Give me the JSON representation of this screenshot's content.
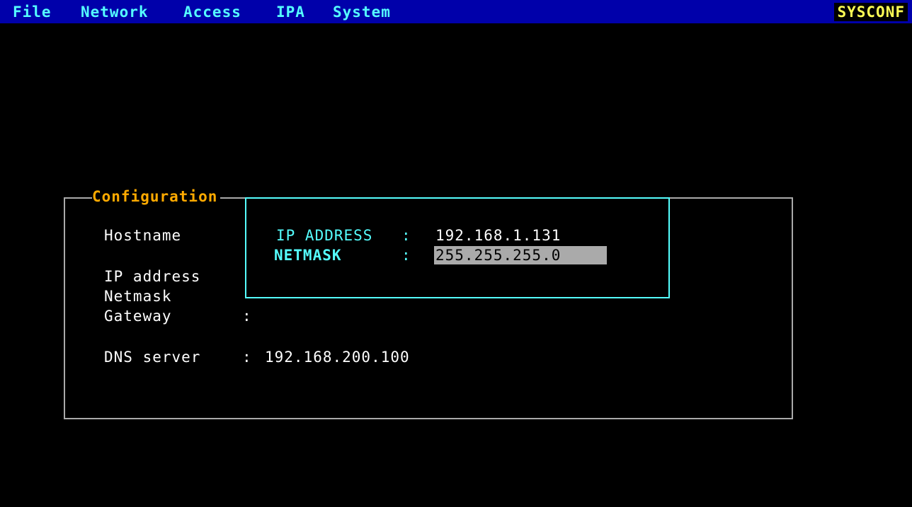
{
  "menu": {
    "items": [
      {
        "label": "File"
      },
      {
        "label": "Network"
      },
      {
        "label": "Access"
      },
      {
        "label": "IPA"
      },
      {
        "label": "System"
      }
    ],
    "app_name": "SYSCONF"
  },
  "config": {
    "title": "Configuration",
    "fields": {
      "hostname": {
        "label": "Hostname",
        "value": ""
      },
      "ip_address": {
        "label": "IP address",
        "value": ""
      },
      "netmask": {
        "label": "Netmask",
        "value": ""
      },
      "gateway": {
        "label": "Gateway",
        "separator": ":",
        "value": ""
      },
      "dns_server": {
        "label": "DNS server",
        "separator": ":",
        "value": "192.168.200.100"
      }
    }
  },
  "dialog": {
    "ip_label": "IP ADDRESS",
    "ip_value": "192.168.1.131",
    "netmask_label": "NETMASK",
    "netmask_value": "255.255.255.0",
    "separator": ":"
  },
  "colors": {
    "menubar_bg": "#0000aa",
    "menu_text": "#55ffff",
    "app_badge_text": "#ffff55",
    "frame_title": "#ffaa00",
    "dialog_border": "#55ffff",
    "input_bg": "#aaaaaa"
  }
}
